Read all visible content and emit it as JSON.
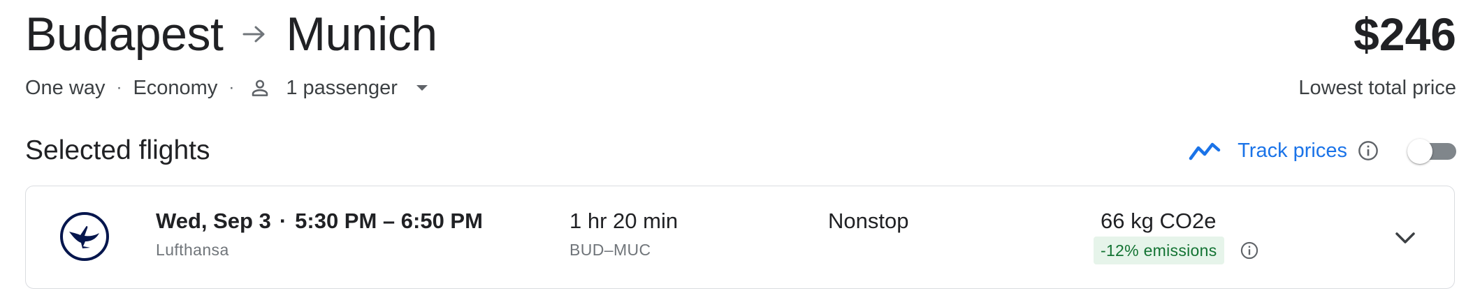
{
  "route": {
    "origin": "Budapest",
    "destination": "Munich"
  },
  "price": {
    "amount": "$246",
    "label": "Lowest total price"
  },
  "trip_options": {
    "trip_type": "One way",
    "cabin": "Economy",
    "passengers": "1 passenger",
    "separator": "·"
  },
  "section": {
    "title": "Selected flights"
  },
  "track_prices": {
    "label": "Track prices",
    "enabled": false
  },
  "flight": {
    "date": "Wed, Sep 3",
    "separator": "·",
    "times": "5:30 PM – 6:50 PM",
    "airline": "Lufthansa",
    "duration": "1 hr 20 min",
    "airports": "BUD–MUC",
    "stops": "Nonstop",
    "emissions": "66 kg CO2e",
    "emissions_delta": "-12% emissions"
  },
  "icons": {
    "route_arrow": "arrow-right-icon",
    "passenger": "person-icon",
    "passenger_dropdown": "caret-down-icon",
    "track": "trending-line-icon",
    "info": "info-icon",
    "airline_logo": "lufthansa-crane-logo",
    "expand": "chevron-down-icon"
  },
  "colors": {
    "accent_blue": "#1a73e8",
    "text_primary": "#202124",
    "text_secondary": "#70757a",
    "emission_badge_bg": "#e6f4ea",
    "emission_badge_text": "#137333",
    "lufthansa_navy": "#05164d",
    "card_border": "#dadce0"
  }
}
